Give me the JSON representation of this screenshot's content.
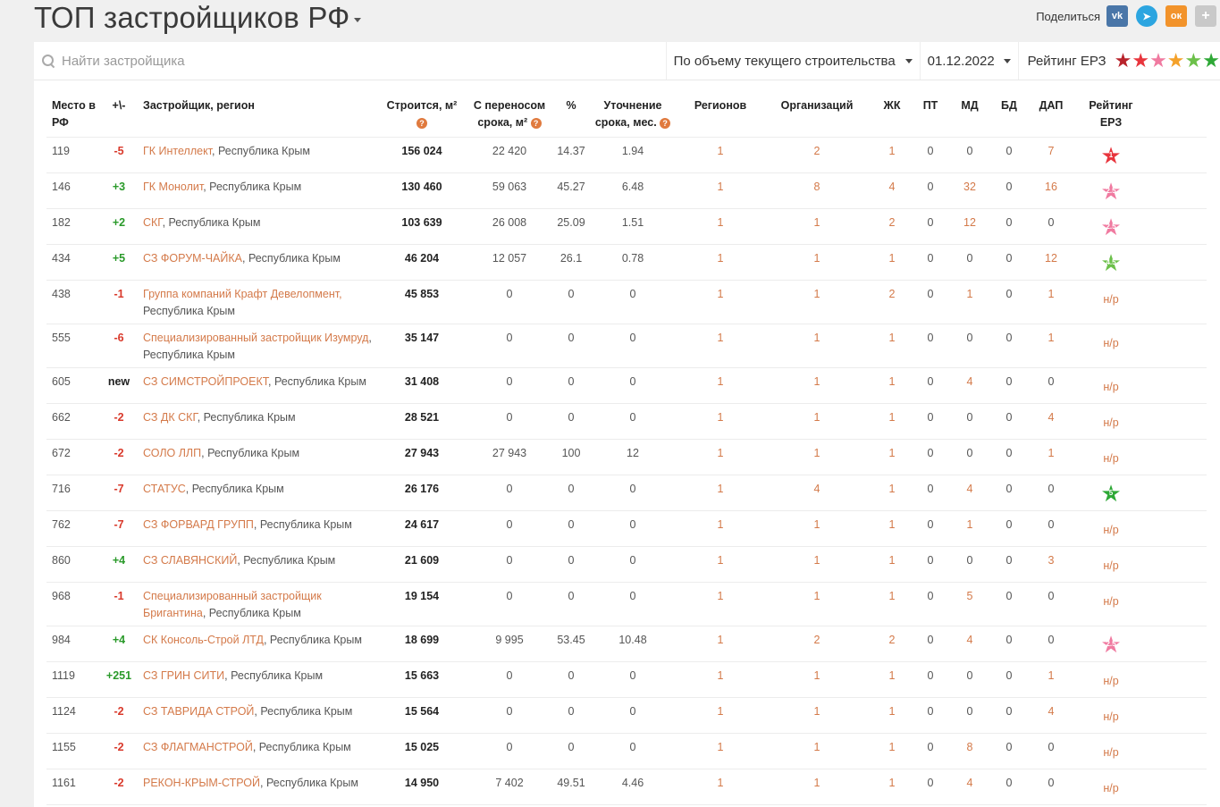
{
  "page_title": "ТОП застройщиков РФ",
  "share": {
    "label": "Поделиться",
    "vk": "vk",
    "tg": "➤",
    "ok": "ок",
    "plus": "+"
  },
  "search": {
    "placeholder": "Найти застройщика",
    "value": ""
  },
  "sort_dropdown": {
    "value": "По объему текущего строительства"
  },
  "date_dropdown": {
    "value": "01.12.2022"
  },
  "rating_filter": {
    "label": "Рейтинг ЕРЗ",
    "star_colors": [
      "#b8232b",
      "#e8353d",
      "#f07aa0",
      "#f4a12a",
      "#6cc04a",
      "#2ea836"
    ]
  },
  "columns": {
    "place": "Место в РФ",
    "delta": "+\\-",
    "developer": "Застройщик, регион",
    "building": "Строится, м²",
    "postponed": "С переносом срока, м²",
    "percent": "%",
    "clarification": "Уточнение срока, мес.",
    "regions": "Регионов",
    "organizations": "Организаций",
    "zhk": "ЖК",
    "pt": "ПТ",
    "md": "МД",
    "bd": "БД",
    "dap": "ДАП",
    "rating": "Рейтинг ЕРЗ"
  },
  "rows": [
    {
      "place": "119",
      "delta": "-5",
      "dtype": "neg",
      "name": "ГК Интеллект",
      "region": ", Республика Крым",
      "building": "156 024",
      "postponed": "22 420",
      "percent": "14.37",
      "clar": "1.94",
      "regions": "1",
      "orgs": "2",
      "zhk": "1",
      "pt": "0",
      "md": "0",
      "bd": "0",
      "dap": "7",
      "rating": "1",
      "rcolor": "#e8353d",
      "tall": false
    },
    {
      "place": "146",
      "delta": "+3",
      "dtype": "pos",
      "name": "ГК Монолит",
      "region": ", Республика Крым",
      "building": "130 460",
      "postponed": "59 063",
      "percent": "45.27",
      "clar": "6.48",
      "regions": "1",
      "orgs": "8",
      "zhk": "4",
      "pt": "0",
      "md": "32",
      "bd": "0",
      "dap": "16",
      "rating": "2.5",
      "rcolor": "#f07aa0",
      "tall": false
    },
    {
      "place": "182",
      "delta": "+2",
      "dtype": "pos",
      "name": "СКГ",
      "region": ", Республика Крым",
      "building": "103 639",
      "postponed": "26 008",
      "percent": "25.09",
      "clar": "1.51",
      "regions": "1",
      "orgs": "1",
      "zhk": "2",
      "pt": "0",
      "md": "12",
      "bd": "0",
      "dap": "0",
      "rating": "2.5",
      "rcolor": "#f07aa0",
      "tall": false
    },
    {
      "place": "434",
      "delta": "+5",
      "dtype": "pos",
      "name": "СЗ ФОРУМ-ЧАЙКА",
      "region": ", Республика Крым",
      "building": "46 204",
      "postponed": "12 057",
      "percent": "26.1",
      "clar": "0.78",
      "regions": "1",
      "orgs": "1",
      "zhk": "1",
      "pt": "0",
      "md": "0",
      "bd": "0",
      "dap": "12",
      "rating": "4.5",
      "rcolor": "#6cc04a",
      "tall": false
    },
    {
      "place": "438",
      "delta": "-1",
      "dtype": "neg",
      "name": "Группа компаний Крафт Девелопмент,",
      "region": "Республика Крым",
      "building": "45 853",
      "postponed": "0",
      "percent": "0",
      "clar": "0",
      "regions": "1",
      "orgs": "1",
      "zhk": "2",
      "pt": "0",
      "md": "1",
      "bd": "0",
      "dap": "1",
      "rating": "н/р",
      "rcolor": "",
      "tall": true,
      "break": true
    },
    {
      "place": "555",
      "delta": "-6",
      "dtype": "neg",
      "name": "Специализированный застройщик Изумруд",
      "region": ", Республика Крым",
      "building": "35 147",
      "postponed": "0",
      "percent": "0",
      "clar": "0",
      "regions": "1",
      "orgs": "1",
      "zhk": "1",
      "pt": "0",
      "md": "0",
      "bd": "0",
      "dap": "1",
      "rating": "н/р",
      "rcolor": "",
      "tall": true
    },
    {
      "place": "605",
      "delta": "new",
      "dtype": "new",
      "name": "СЗ СИМСТРОЙПРОЕКТ",
      "region": ", Республика Крым",
      "building": "31 408",
      "postponed": "0",
      "percent": "0",
      "clar": "0",
      "regions": "1",
      "orgs": "1",
      "zhk": "1",
      "pt": "0",
      "md": "4",
      "bd": "0",
      "dap": "0",
      "rating": "н/р",
      "rcolor": "",
      "tall": false
    },
    {
      "place": "662",
      "delta": "-2",
      "dtype": "neg",
      "name": "СЗ ДК СКГ",
      "region": ", Республика Крым",
      "building": "28 521",
      "postponed": "0",
      "percent": "0",
      "clar": "0",
      "regions": "1",
      "orgs": "1",
      "zhk": "1",
      "pt": "0",
      "md": "0",
      "bd": "0",
      "dap": "4",
      "rating": "н/р",
      "rcolor": "",
      "tall": false
    },
    {
      "place": "672",
      "delta": "-2",
      "dtype": "neg",
      "name": "СОЛО ЛЛП",
      "region": ", Республика Крым",
      "building": "27 943",
      "postponed": "27 943",
      "percent": "100",
      "clar": "12",
      "regions": "1",
      "orgs": "1",
      "zhk": "1",
      "pt": "0",
      "md": "0",
      "bd": "0",
      "dap": "1",
      "rating": "н/р",
      "rcolor": "",
      "tall": false
    },
    {
      "place": "716",
      "delta": "-7",
      "dtype": "neg",
      "name": "СТАТУС",
      "region": ", Республика Крым",
      "building": "26 176",
      "postponed": "0",
      "percent": "0",
      "clar": "0",
      "regions": "1",
      "orgs": "4",
      "zhk": "1",
      "pt": "0",
      "md": "4",
      "bd": "0",
      "dap": "0",
      "rating": "5",
      "rcolor": "#2ea836",
      "tall": false
    },
    {
      "place": "762",
      "delta": "-7",
      "dtype": "neg",
      "name": "СЗ ФОРВАРД ГРУПП",
      "region": ", Республика Крым",
      "building": "24 617",
      "postponed": "0",
      "percent": "0",
      "clar": "0",
      "regions": "1",
      "orgs": "1",
      "zhk": "1",
      "pt": "0",
      "md": "1",
      "bd": "0",
      "dap": "0",
      "rating": "н/р",
      "rcolor": "",
      "tall": false
    },
    {
      "place": "860",
      "delta": "+4",
      "dtype": "pos",
      "name": "СЗ СЛАВЯНСКИЙ",
      "region": ", Республика Крым",
      "building": "21 609",
      "postponed": "0",
      "percent": "0",
      "clar": "0",
      "regions": "1",
      "orgs": "1",
      "zhk": "1",
      "pt": "0",
      "md": "0",
      "bd": "0",
      "dap": "3",
      "rating": "н/р",
      "rcolor": "",
      "tall": false
    },
    {
      "place": "968",
      "delta": "-1",
      "dtype": "neg",
      "name": "Специализированный застройщик Бригантина",
      "region": ", Республика Крым",
      "building": "19 154",
      "postponed": "0",
      "percent": "0",
      "clar": "0",
      "regions": "1",
      "orgs": "1",
      "zhk": "1",
      "pt": "0",
      "md": "5",
      "bd": "0",
      "dap": "0",
      "rating": "н/р",
      "rcolor": "",
      "tall": true
    },
    {
      "place": "984",
      "delta": "+4",
      "dtype": "pos",
      "name": "СК Консоль-Строй ЛТД",
      "region": ", Республика Крым",
      "building": "18 699",
      "postponed": "9 995",
      "percent": "53.45",
      "clar": "10.48",
      "regions": "1",
      "orgs": "2",
      "zhk": "2",
      "pt": "0",
      "md": "4",
      "bd": "0",
      "dap": "0",
      "rating": "2.5",
      "rcolor": "#f07aa0",
      "tall": false
    },
    {
      "place": "1119",
      "delta": "+251",
      "dtype": "pos",
      "name": "СЗ ГРИН СИТИ",
      "region": ", Республика Крым",
      "building": "15 663",
      "postponed": "0",
      "percent": "0",
      "clar": "0",
      "regions": "1",
      "orgs": "1",
      "zhk": "1",
      "pt": "0",
      "md": "0",
      "bd": "0",
      "dap": "1",
      "rating": "н/р",
      "rcolor": "",
      "tall": false
    },
    {
      "place": "1124",
      "delta": "-2",
      "dtype": "neg",
      "name": "СЗ ТАВРИДА СТРОЙ",
      "region": ", Республика Крым",
      "building": "15 564",
      "postponed": "0",
      "percent": "0",
      "clar": "0",
      "regions": "1",
      "orgs": "1",
      "zhk": "1",
      "pt": "0",
      "md": "0",
      "bd": "0",
      "dap": "4",
      "rating": "н/р",
      "rcolor": "",
      "tall": false
    },
    {
      "place": "1155",
      "delta": "-2",
      "dtype": "neg",
      "name": "СЗ ФЛАГМАНСТРОЙ",
      "region": ", Республика Крым",
      "building": "15 025",
      "postponed": "0",
      "percent": "0",
      "clar": "0",
      "regions": "1",
      "orgs": "1",
      "zhk": "1",
      "pt": "0",
      "md": "8",
      "bd": "0",
      "dap": "0",
      "rating": "н/р",
      "rcolor": "",
      "tall": false
    },
    {
      "place": "1161",
      "delta": "-2",
      "dtype": "neg",
      "name": "РЕКОН-КРЫМ-СТРОЙ",
      "region": ", Республика Крым",
      "building": "14 950",
      "postponed": "7 402",
      "percent": "49.51",
      "clar": "4.46",
      "regions": "1",
      "orgs": "1",
      "zhk": "1",
      "pt": "0",
      "md": "4",
      "bd": "0",
      "dap": "0",
      "rating": "н/р",
      "rcolor": "",
      "tall": false
    }
  ]
}
